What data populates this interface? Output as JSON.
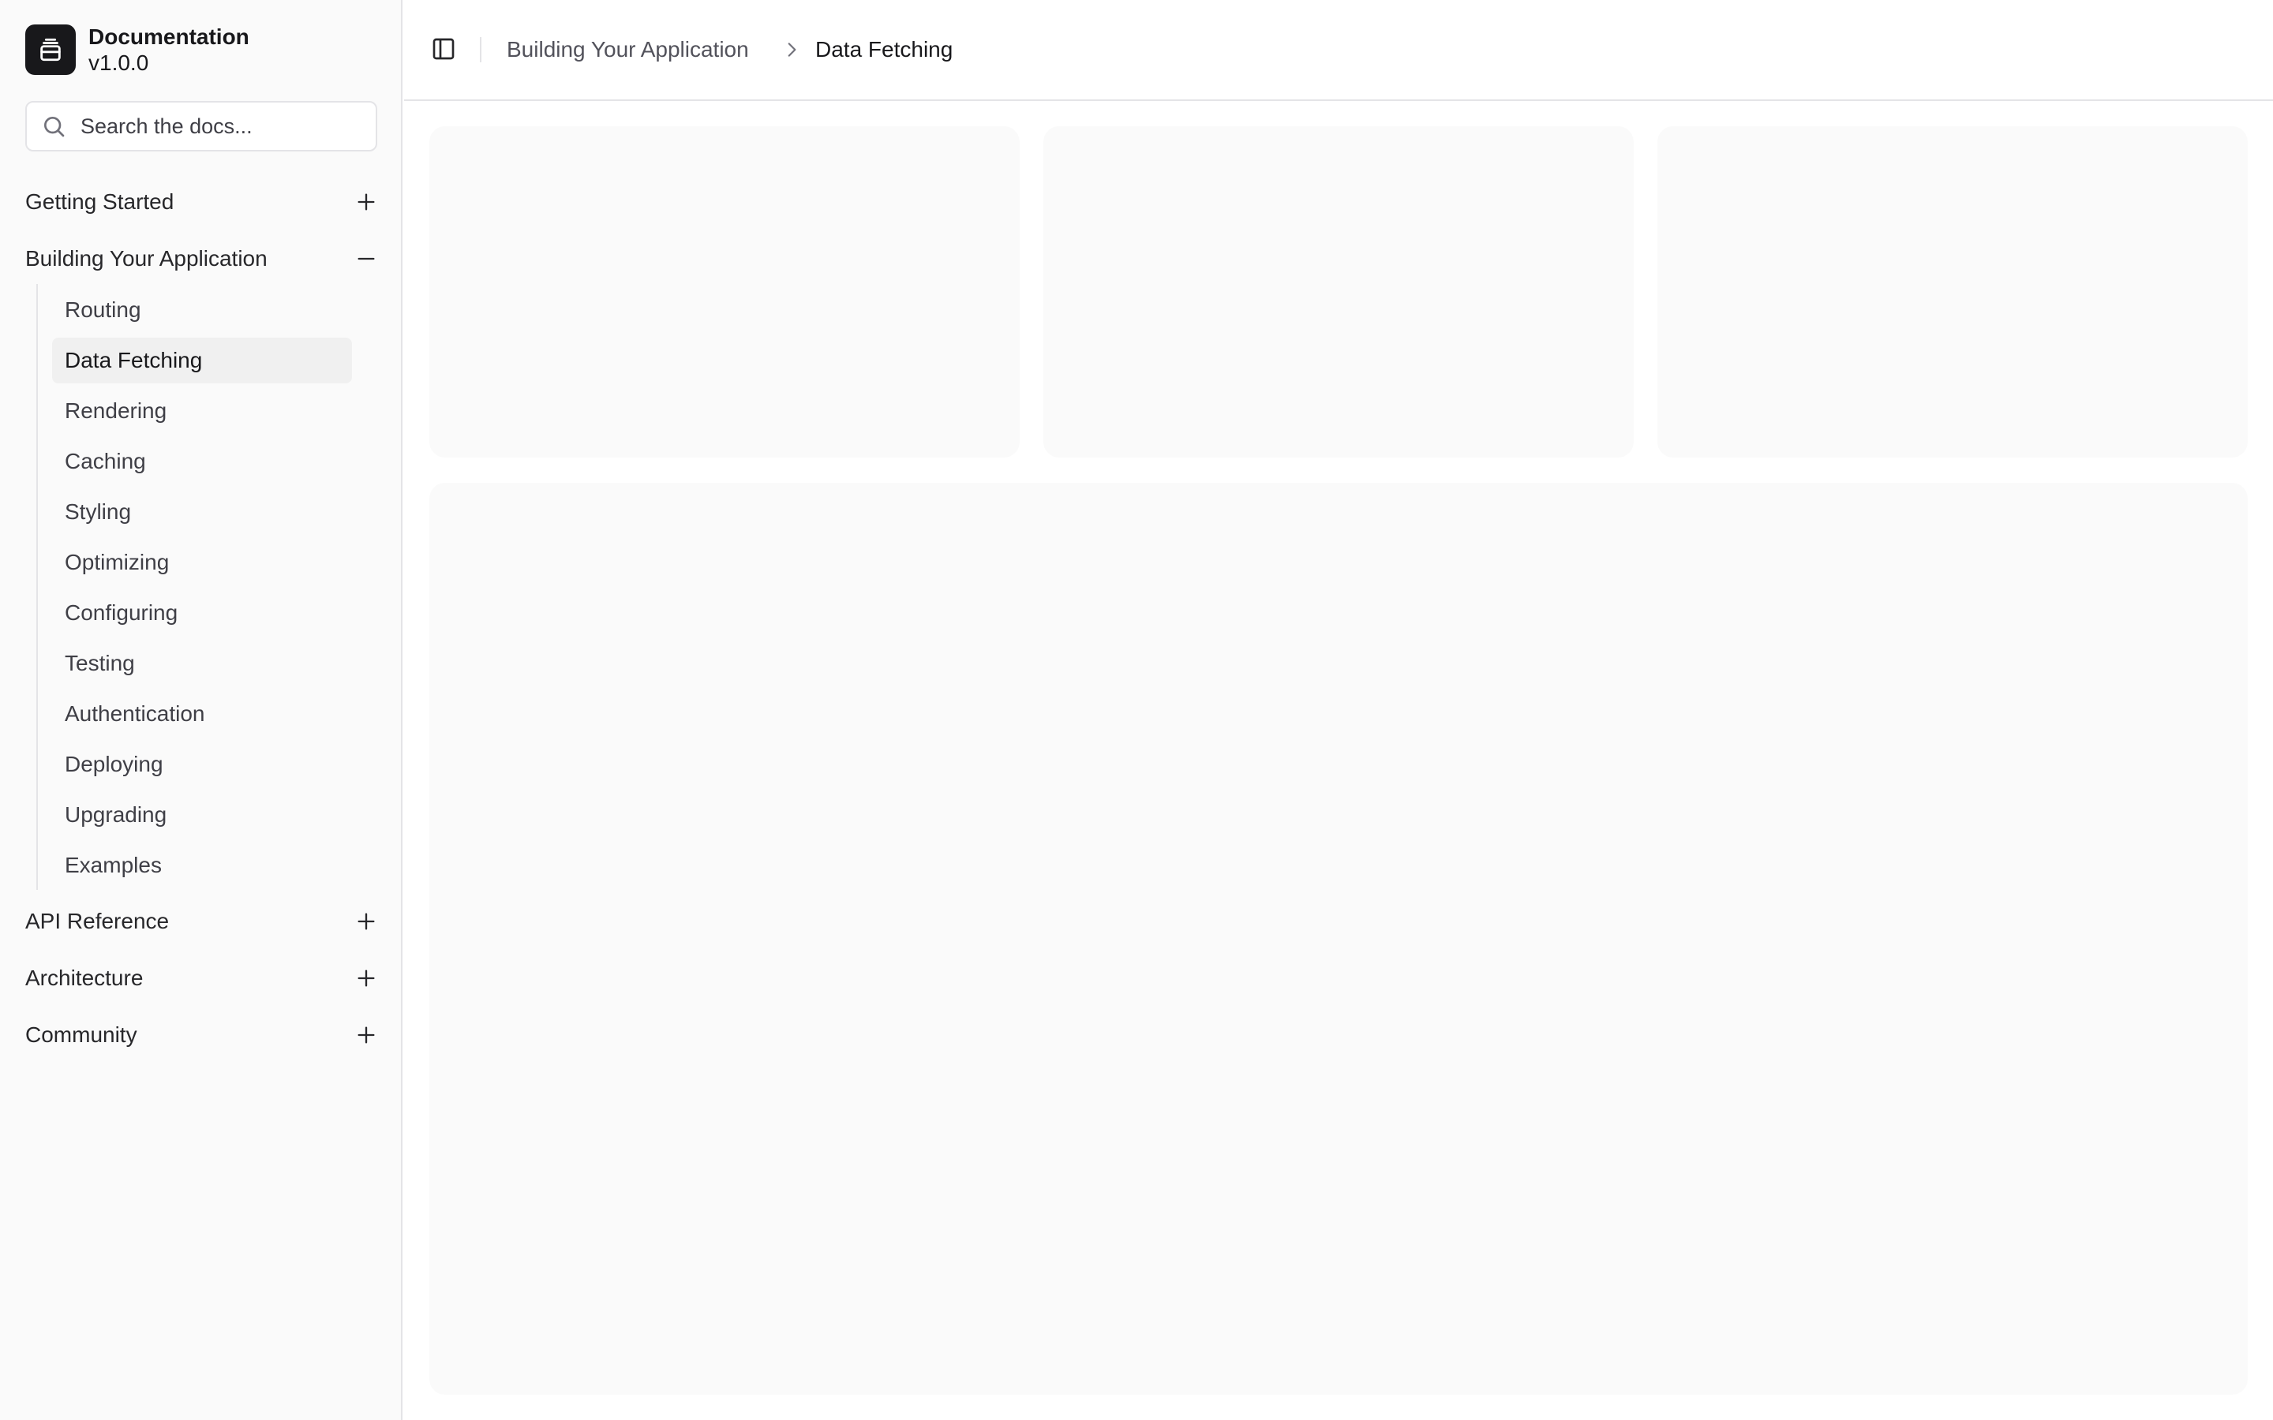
{
  "brand": {
    "title": "Documentation",
    "version": "v1.0.0",
    "logo_icon": "layers-icon"
  },
  "search": {
    "placeholder": "Search the docs..."
  },
  "sidebar": {
    "sections": [
      {
        "label": "Getting Started",
        "state": "collapsed",
        "icon": "plus-icon"
      },
      {
        "label": "Building Your Application",
        "state": "expanded",
        "icon": "minus-icon"
      },
      {
        "label": "API Reference",
        "state": "collapsed",
        "icon": "plus-icon"
      },
      {
        "label": "Architecture",
        "state": "collapsed",
        "icon": "plus-icon"
      },
      {
        "label": "Community",
        "state": "collapsed",
        "icon": "plus-icon"
      }
    ],
    "subitems": [
      {
        "label": "Routing"
      },
      {
        "label": "Data Fetching",
        "active": true
      },
      {
        "label": "Rendering"
      },
      {
        "label": "Caching"
      },
      {
        "label": "Styling"
      },
      {
        "label": "Optimizing"
      },
      {
        "label": "Configuring"
      },
      {
        "label": "Testing"
      },
      {
        "label": "Authentication"
      },
      {
        "label": "Deploying"
      },
      {
        "label": "Upgrading"
      },
      {
        "label": "Examples"
      }
    ]
  },
  "header": {
    "toggle_icon": "sidebar-toggle-icon",
    "breadcrumb": {
      "parent": "Building Your Application",
      "current": "Data Fetching",
      "separator_icon": "chevron-right-icon"
    }
  },
  "colors": {
    "sidebar_bg": "#fafafa",
    "active_item_bg": "#f0f0f0",
    "placeholder_bg": "#fafafa",
    "border": "#e4e4e7",
    "logo_bg": "#18181b"
  }
}
